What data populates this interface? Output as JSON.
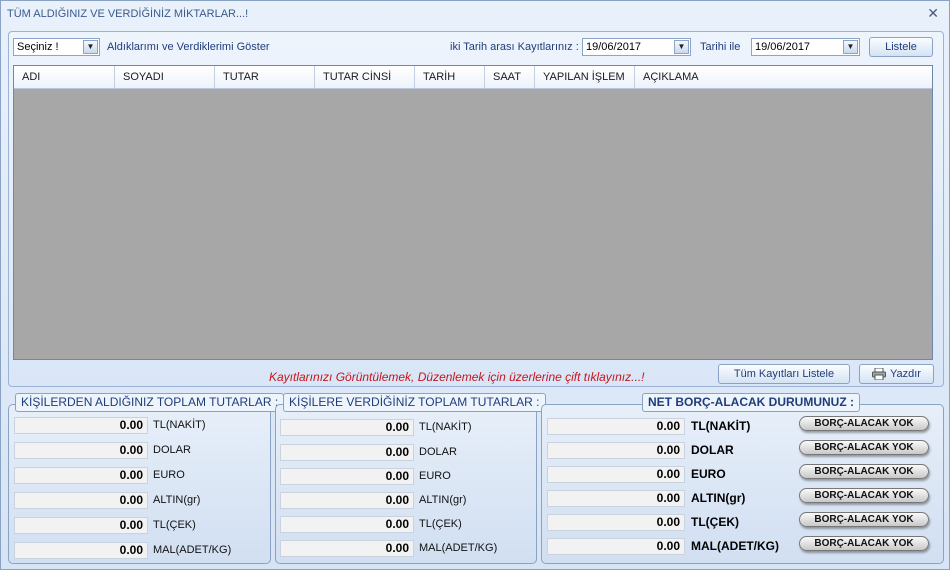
{
  "window": {
    "title": "TÜM ALDIĞINIZ VE VERDİĞİNİZ MİKTARLAR...!",
    "close_glyph": "✕"
  },
  "filter": {
    "select_value": "Seçiniz !",
    "select_label": "Aldıklarımı ve Verdiklerimi Göster",
    "range_label": "iki Tarih arası Kayıtlarınız :",
    "date_from": "19/06/2017",
    "date_between": "Tarihi ile",
    "date_to": "19/06/2017",
    "list_button": "Listele"
  },
  "grid": {
    "columns": [
      "ADI",
      "SOYADI",
      "TUTAR",
      "TUTAR CİNSİ",
      "TARİH",
      "SAAT",
      "YAPILAN İŞLEM",
      "AÇIKLAMA"
    ]
  },
  "hint": "Kayıtlarınızı Görüntülemek, Düzenlemek için üzerlerine çift tıklayınız...!",
  "actions": {
    "list_all": "Tüm Kayıtları Listele",
    "print": "Yazdır"
  },
  "received": {
    "title": "KİŞİLERDEN ALDIĞINIZ TOPLAM TUTARLAR :",
    "rows": [
      {
        "value": "0.00",
        "currency": "TL(NAKİT)"
      },
      {
        "value": "0.00",
        "currency": "DOLAR"
      },
      {
        "value": "0.00",
        "currency": "EURO"
      },
      {
        "value": "0.00",
        "currency": "ALTIN(gr)"
      },
      {
        "value": "0.00",
        "currency": "TL(ÇEK)"
      },
      {
        "value": "0.00",
        "currency": "MAL(ADET/KG)"
      }
    ]
  },
  "given": {
    "title": "KİŞİLERE VERDİĞİNİZ TOPLAM TUTARLAR :",
    "rows": [
      {
        "value": "0.00",
        "currency": "TL(NAKİT)"
      },
      {
        "value": "0.00",
        "currency": "DOLAR"
      },
      {
        "value": "0.00",
        "currency": "EURO"
      },
      {
        "value": "0.00",
        "currency": "ALTIN(gr)"
      },
      {
        "value": "0.00",
        "currency": "TL(ÇEK)"
      },
      {
        "value": "0.00",
        "currency": "MAL(ADET/KG)"
      }
    ]
  },
  "net": {
    "title": "NET BORÇ-ALACAK DURUMUNUZ :",
    "rows": [
      {
        "value": "0.00",
        "currency": "TL(NAKİT)",
        "status": "BORÇ-ALACAK YOK"
      },
      {
        "value": "0.00",
        "currency": "DOLAR",
        "status": "BORÇ-ALACAK YOK"
      },
      {
        "value": "0.00",
        "currency": "EURO",
        "status": "BORÇ-ALACAK YOK"
      },
      {
        "value": "0.00",
        "currency": "ALTIN(gr)",
        "status": "BORÇ-ALACAK YOK"
      },
      {
        "value": "0.00",
        "currency": "TL(ÇEK)",
        "status": "BORÇ-ALACAK YOK"
      },
      {
        "value": "0.00",
        "currency": "MAL(ADET/KG)",
        "status": "BORÇ-ALACAK YOK"
      }
    ]
  }
}
